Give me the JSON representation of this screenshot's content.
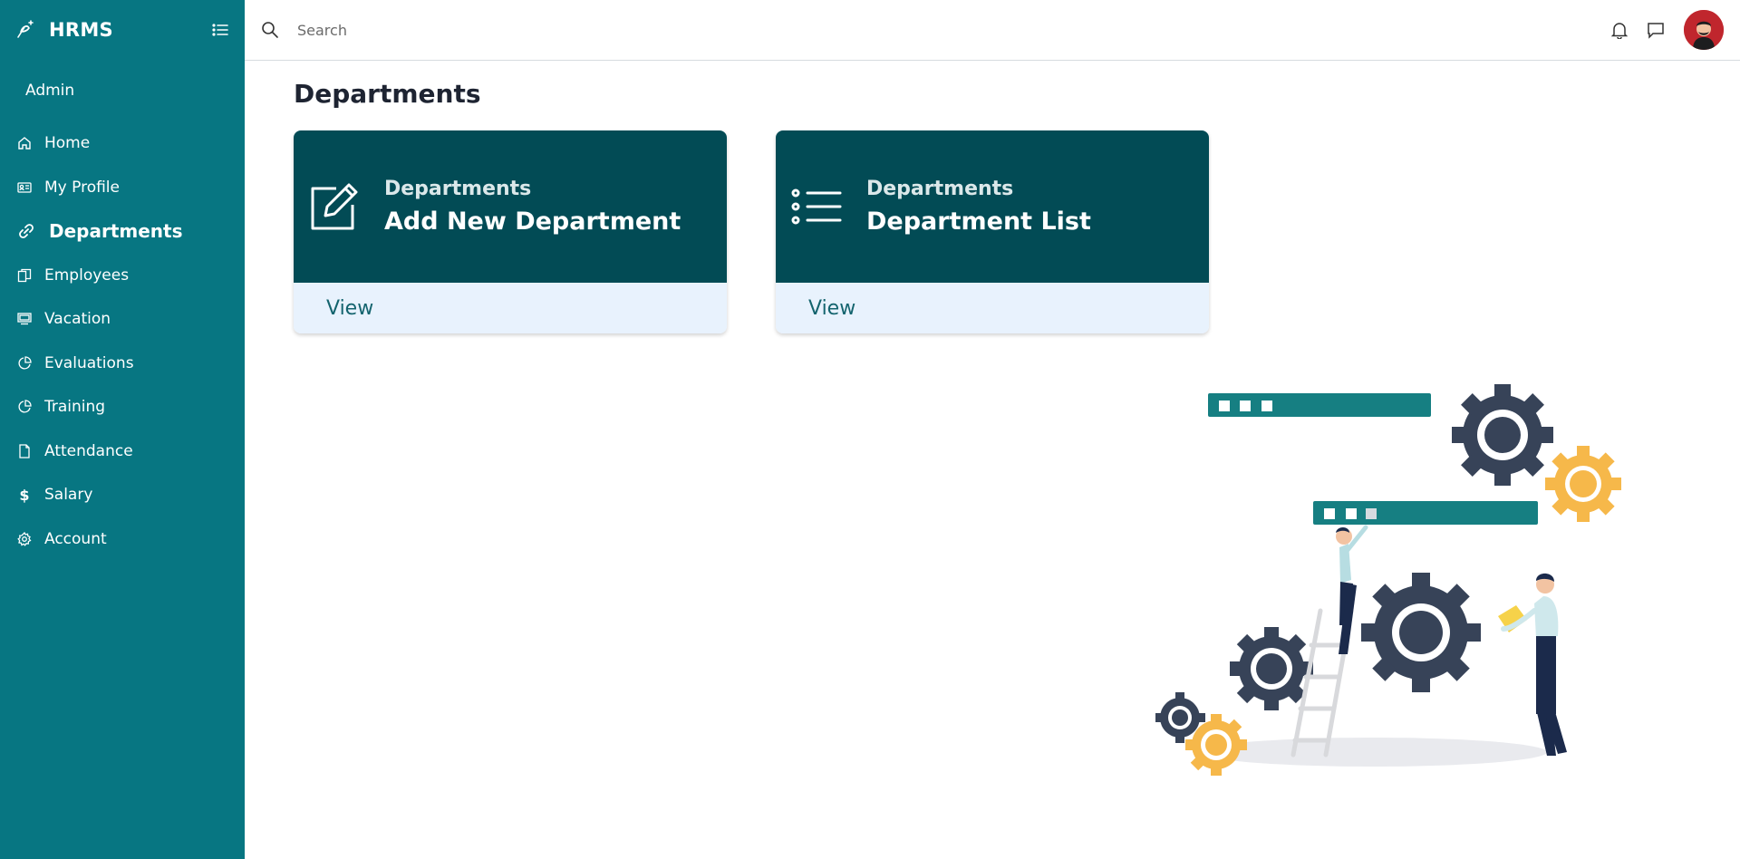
{
  "app": {
    "title": "HRMS"
  },
  "sidebar": {
    "user": "Admin",
    "items": [
      {
        "label": "Home",
        "icon": "home-icon"
      },
      {
        "label": "My Profile",
        "icon": "id-card-icon"
      },
      {
        "label": "Departments",
        "icon": "link-icon",
        "active": true
      },
      {
        "label": "Employees",
        "icon": "copy-icon"
      },
      {
        "label": "Vacation",
        "icon": "monitor-icon"
      },
      {
        "label": "Evaluations",
        "icon": "pie-chart-icon"
      },
      {
        "label": "Training",
        "icon": "pie-chart-icon"
      },
      {
        "label": "Attendance",
        "icon": "file-icon"
      },
      {
        "label": "Salary",
        "icon": "dollar-icon"
      },
      {
        "label": "Account",
        "icon": "gear-icon"
      }
    ]
  },
  "topbar": {
    "search_placeholder": "Search"
  },
  "main": {
    "title": "Departments",
    "cards": [
      {
        "kicker": "Departments",
        "heading": "Add New Department",
        "action": "View",
        "icon": "edit-icon"
      },
      {
        "kicker": "Departments",
        "heading": "Department List",
        "action": "View",
        "icon": "list-icon"
      }
    ]
  },
  "colors": {
    "sidebar_bg": "#077682",
    "card_top": "#024b55",
    "card_bottom": "#e8f2fd",
    "avatar_bg": "#c0262d"
  }
}
